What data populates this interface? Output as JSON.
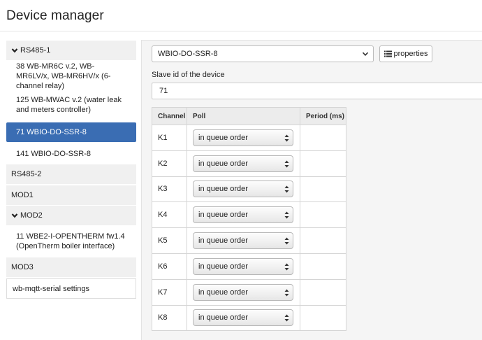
{
  "page": {
    "title": "Device manager"
  },
  "sidebar": {
    "items": [
      {
        "kind": "group",
        "label": "RS485-1",
        "expanded": true
      },
      {
        "kind": "device",
        "label": "38 WB-MR6C v.2, WB-MR6LV/x, WB-MR6HV/x (6-channel relay)",
        "active": false
      },
      {
        "kind": "device",
        "label": "125 WB-MWAC v.2 (water leak and meters controller)",
        "active": false
      },
      {
        "kind": "device",
        "label": "71 WBIO-DO-SSR-8",
        "active": true
      },
      {
        "kind": "device",
        "label": "141 WBIO-DO-SSR-8",
        "active": false
      },
      {
        "kind": "group",
        "label": "RS485-2",
        "expanded": false
      },
      {
        "kind": "group",
        "label": "MOD1",
        "expanded": false
      },
      {
        "kind": "group",
        "label": "MOD2",
        "expanded": true
      },
      {
        "kind": "device",
        "label": "11 WBE2-I-OPENTHERM fw1.4 (OpenTherm boiler interface)",
        "active": false
      },
      {
        "kind": "group",
        "label": "MOD3",
        "expanded": false
      },
      {
        "kind": "settings",
        "label": "wb-mqtt-serial settings"
      }
    ]
  },
  "device_form": {
    "device_type": "WBIO-DO-SSR-8",
    "properties_label": "properties",
    "slave_id_label": "Slave id of the device",
    "slave_id_value": "71"
  },
  "channels": {
    "headers": {
      "channel": "Channel",
      "poll": "Poll",
      "period": "Period (ms)"
    },
    "rows": [
      {
        "channel": "K1",
        "poll": "in queue order",
        "period": ""
      },
      {
        "channel": "K2",
        "poll": "in queue order",
        "period": ""
      },
      {
        "channel": "K3",
        "poll": "in queue order",
        "period": ""
      },
      {
        "channel": "K4",
        "poll": "in queue order",
        "period": ""
      },
      {
        "channel": "K5",
        "poll": "in queue order",
        "period": ""
      },
      {
        "channel": "K6",
        "poll": "in queue order",
        "period": ""
      },
      {
        "channel": "K7",
        "poll": "in queue order",
        "period": ""
      },
      {
        "channel": "K8",
        "poll": "in queue order",
        "period": ""
      }
    ]
  },
  "colors": {
    "active_item": "#3a6db3",
    "group_bg": "#f0f0f0",
    "panel_bg": "#f5f5f5"
  }
}
